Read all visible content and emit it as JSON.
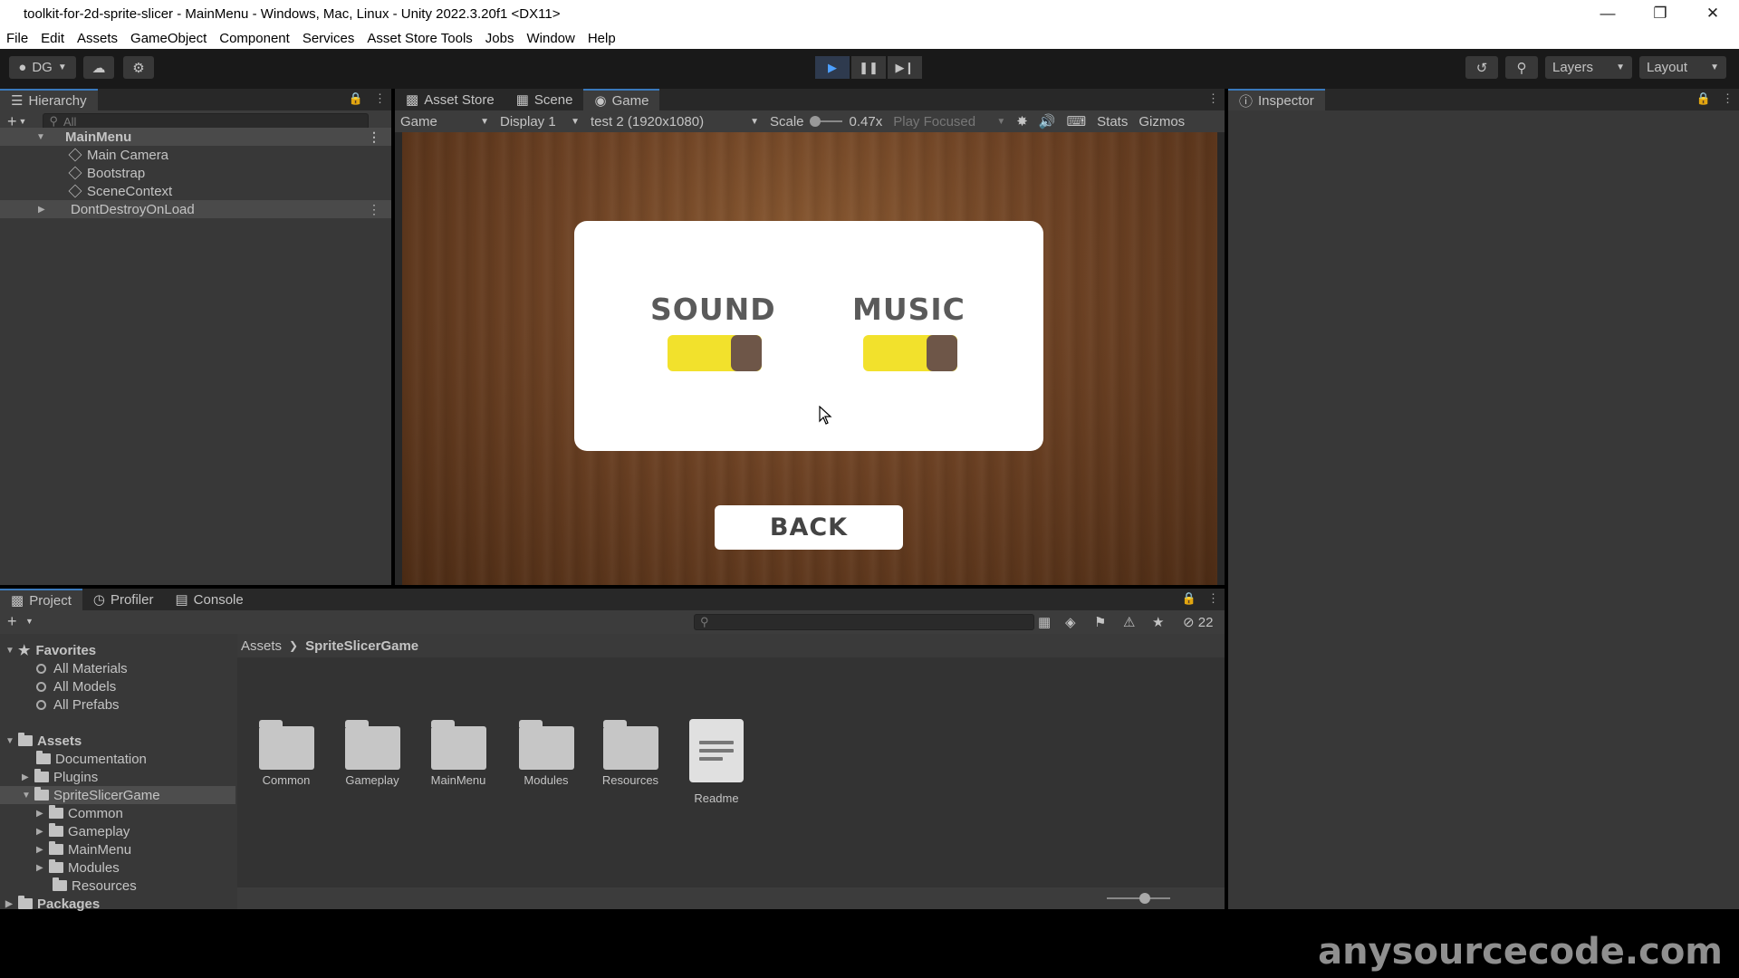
{
  "window": {
    "title": "toolkit-for-2d-sprite-slicer - MainMenu - Windows, Mac, Linux - Unity 2022.3.20f1 <DX11>"
  },
  "menu": [
    "File",
    "Edit",
    "Assets",
    "GameObject",
    "Component",
    "Services",
    "Asset Store Tools",
    "Jobs",
    "Window",
    "Help"
  ],
  "toolbar": {
    "account": "DG",
    "layers": "Layers",
    "layout": "Layout"
  },
  "hierarchy": {
    "tab": "Hierarchy",
    "search_placeholder": "All",
    "scene": "MainMenu",
    "items": [
      "Main Camera",
      "Bootstrap",
      "SceneContext"
    ],
    "dont_destroy": "DontDestroyOnLoad"
  },
  "center_tabs": [
    "Asset Store",
    "Scene",
    "Game"
  ],
  "game_toolbar": {
    "view": "Game",
    "display": "Display 1",
    "resolution": "test 2 (1920x1080)",
    "scale_label": "Scale",
    "scale_value": "0.47x",
    "play_focused": "Play Focused",
    "stats": "Stats",
    "gizmos": "Gizmos"
  },
  "game": {
    "sound_label": "SOUND",
    "music_label": "MUSIC",
    "sound_on": true,
    "music_on": true,
    "back_label": "BACK"
  },
  "inspector": {
    "tab": "Inspector"
  },
  "bottom_tabs": [
    "Project",
    "Profiler",
    "Console"
  ],
  "project": {
    "hidden_count": "22",
    "favorites": {
      "label": "Favorites",
      "items": [
        "All Materials",
        "All Models",
        "All Prefabs"
      ]
    },
    "assets_label": "Assets",
    "tree": {
      "documentation": "Documentation",
      "plugins": "Plugins",
      "sprite_slicer_game": "SpriteSlicerGame",
      "children": [
        "Common",
        "Gameplay",
        "MainMenu",
        "Modules",
        "Resources"
      ],
      "packages": "Packages"
    },
    "breadcrumb": [
      "Assets",
      "SpriteSlicerGame"
    ],
    "grid": [
      "Common",
      "Gameplay",
      "MainMenu",
      "Modules",
      "Resources",
      "Readme"
    ]
  },
  "watermark": "anysourcecode.com",
  "colors": {
    "toggle_on": "#f2e12c",
    "toggle_knob": "#6e5648",
    "play_active": "#4da0ff"
  }
}
